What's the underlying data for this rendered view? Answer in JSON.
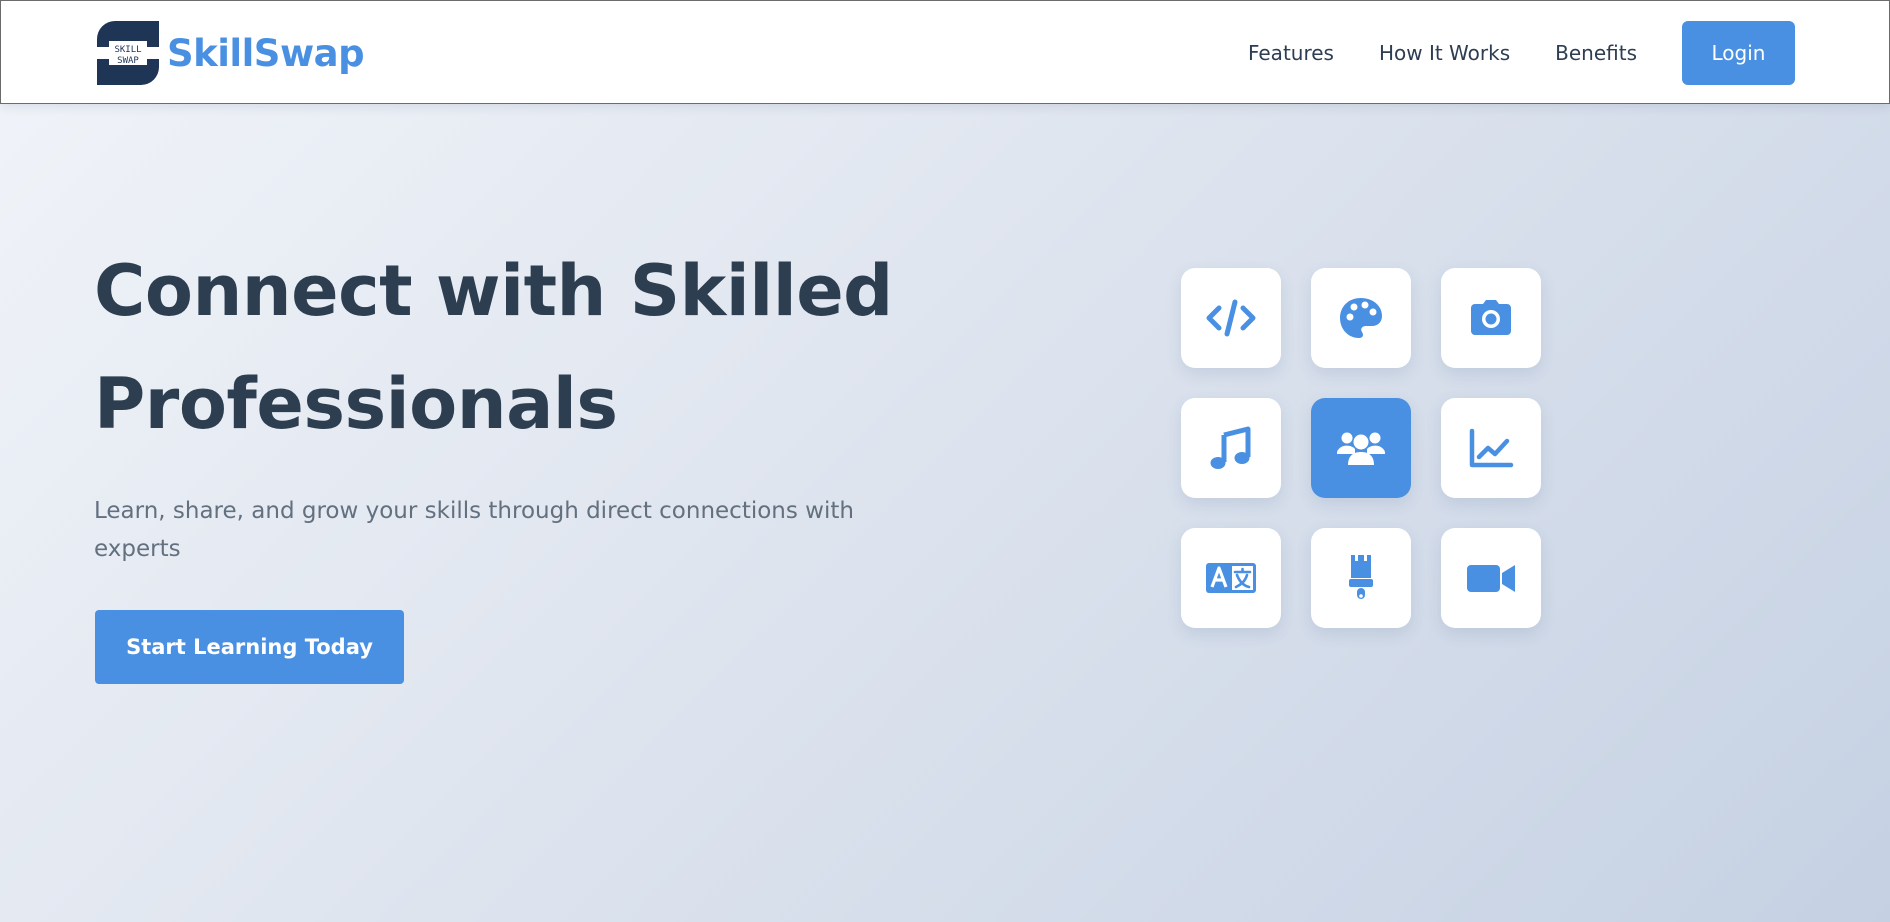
{
  "brand": {
    "logo_mark_text_top": "SKILL",
    "logo_mark_text_bottom": "SWAP",
    "name": "SkillSwap"
  },
  "nav": {
    "links": [
      "Features",
      "How It Works",
      "Benefits"
    ],
    "login_label": "Login"
  },
  "hero": {
    "title_line1": "Connect with Skilled",
    "title_line2": "Professionals",
    "subtitle": "Learn, share, and grow your skills through direct connections with experts",
    "cta_label": "Start Learning Today"
  },
  "skills_grid": {
    "icons": [
      "code-icon",
      "palette-icon",
      "camera-icon",
      "music-icon",
      "users-icon",
      "chart-line-icon",
      "language-icon",
      "paintbrush-icon",
      "video-icon"
    ],
    "active_index": 4
  },
  "colors": {
    "accent": "#4a90e2",
    "heading": "#2c3e50",
    "body_text": "#62707f",
    "logo_dark": "#1e3556"
  }
}
